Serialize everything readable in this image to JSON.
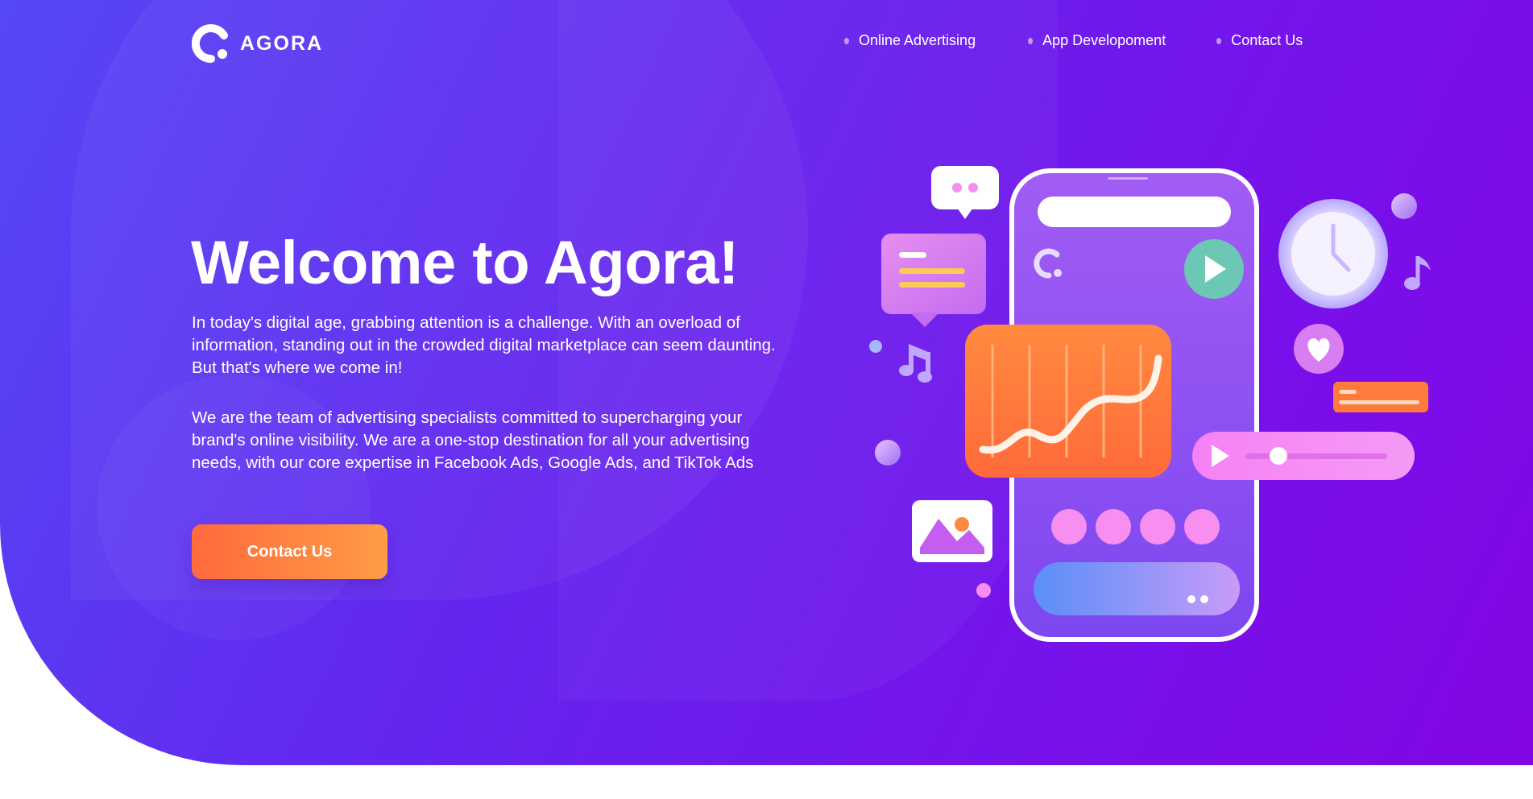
{
  "brand": {
    "name": "AGORA"
  },
  "nav": {
    "items": [
      {
        "label": "Online Advertising"
      },
      {
        "label": "App Developoment"
      },
      {
        "label": "Contact Us"
      }
    ]
  },
  "hero": {
    "title": "Welcome to Agora!",
    "paragraph1": "In today's digital age, grabbing attention is a challenge. With an overload of information, standing out in the crowded digital marketplace can seem daunting. But that's where we come in!",
    "paragraph2": "We are the team of advertising specialists committed to supercharging your brand's online visibility. We are a one-stop destination for all your advertising needs, with our core expertise in Facebook Ads, Google Ads, and TikTok Ads",
    "cta_label": "Contact Us"
  },
  "colors": {
    "hero_gradient_start": "#5548f5",
    "hero_gradient_end": "#8206e4",
    "cta_start": "#ff6a3d",
    "cta_end": "#ff9c45",
    "text": "#ffffff"
  },
  "icons": [
    "agora-logo-icon",
    "nav-bullet-icon",
    "chat-bubble-icon",
    "message-card-icon",
    "music-note-icon",
    "clock-icon",
    "heart-icon",
    "play-icon",
    "image-icon",
    "chart-card-icon",
    "smartphone-icon"
  ]
}
